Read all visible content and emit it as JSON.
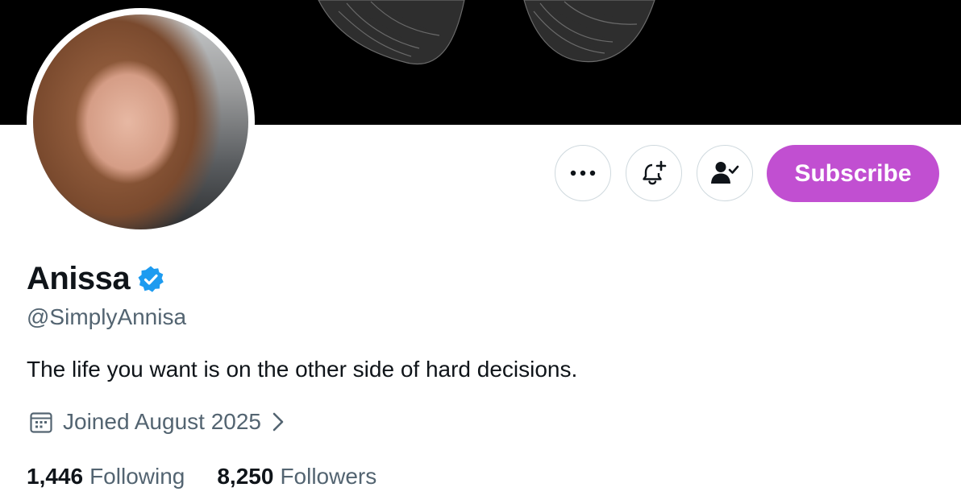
{
  "profile": {
    "display_name": "Anissa",
    "handle": "@SimplyAnnisa",
    "bio": "The life you want is on the other side of hard decisions.",
    "joined": "Joined August 2025",
    "verified": true
  },
  "actions": {
    "more_icon": "more-icon",
    "notify_icon": "bell-plus-icon",
    "following_icon": "person-check-icon",
    "subscribe_label": "Subscribe"
  },
  "stats": {
    "following_count": "1,446",
    "following_label": "Following",
    "followers_count": "8,250",
    "followers_label": "Followers"
  },
  "colors": {
    "subscribe": "#c14fd1",
    "verified": "#1d9bf0",
    "secondary_text": "#536471"
  }
}
